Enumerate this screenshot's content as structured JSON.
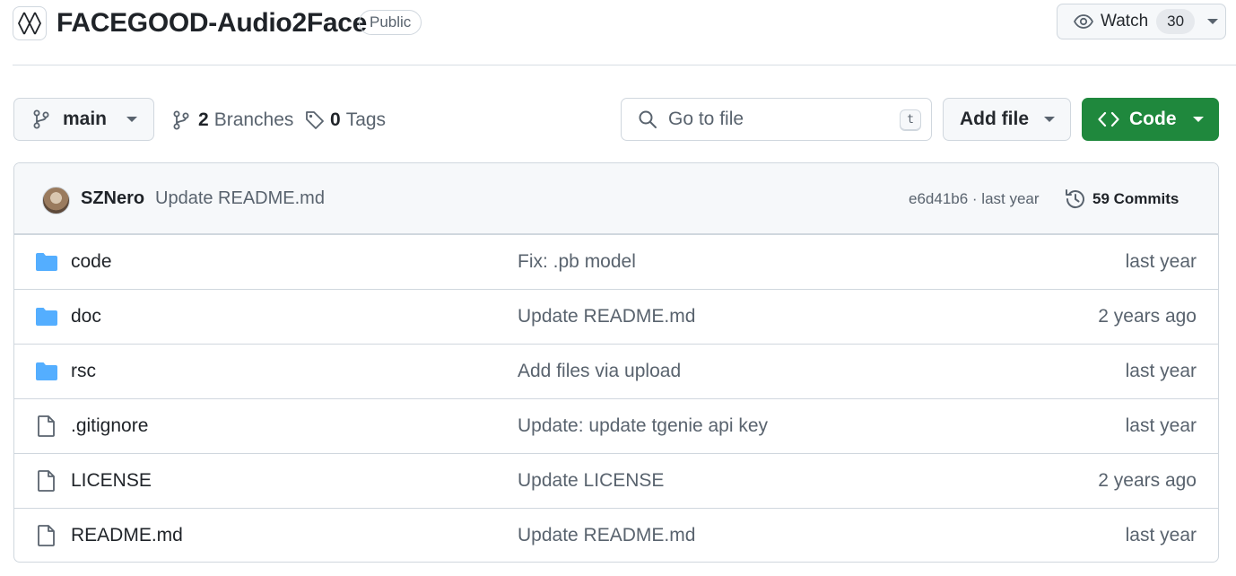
{
  "repo": {
    "name": "FACEGOOD-Audio2Face",
    "visibility": "Public",
    "watch_label": "Watch",
    "watch_count": "30"
  },
  "toolbar": {
    "branch": "main",
    "branches_count": "2",
    "branches_label": "Branches",
    "tags_count": "0",
    "tags_label": "Tags",
    "search_placeholder": "Go to file",
    "search_shortcut": "t",
    "add_file_label": "Add file",
    "code_label": "Code"
  },
  "latest_commit": {
    "author": "SZNero",
    "message": "Update README.md",
    "meta": "e6d41b6 · last year",
    "commits_label": "59 Commits"
  },
  "files": [
    {
      "name": "code",
      "type": "folder",
      "message": "Fix: .pb model",
      "age": "last year"
    },
    {
      "name": "doc",
      "type": "folder",
      "message": "Update README.md",
      "age": "2 years ago"
    },
    {
      "name": "rsc",
      "type": "folder",
      "message": "Add files via upload",
      "age": "last year"
    },
    {
      "name": ".gitignore",
      "type": "file",
      "message": "Update: update tgenie api key",
      "age": "last year"
    },
    {
      "name": "LICENSE",
      "type": "file",
      "message": "Update LICENSE",
      "age": "2 years ago"
    },
    {
      "name": "README.md",
      "type": "file",
      "message": "Update README.md",
      "age": "last year"
    }
  ],
  "colors": {
    "primary_button": "#1f883d",
    "folder_icon": "#54aeff",
    "muted_text": "#59636e",
    "border": "#d0d7de"
  }
}
